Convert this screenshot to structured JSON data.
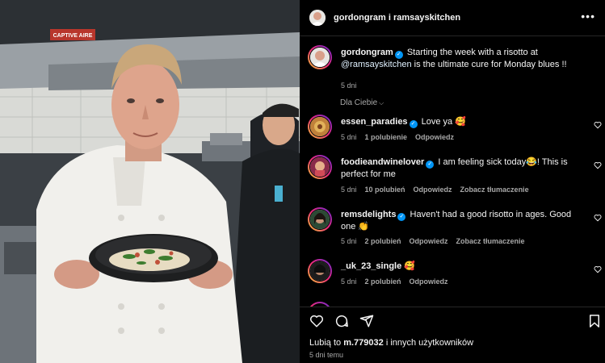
{
  "header": {
    "title": "gordongram i ramsayskitchen",
    "more_icon": "ellipsis-icon"
  },
  "photo": {
    "sign_text": "CAPTIVE AIRE"
  },
  "caption": {
    "username": "gordongram",
    "text_before": "Starting the week with a risotto at",
    "mention": "@ramsayskitchen",
    "text_after": "is the ultimate cure for Monday blues !!",
    "time": "5 dni"
  },
  "filter": {
    "label": "Dla Ciebie",
    "icon": "chevron-down-icon"
  },
  "comments": [
    {
      "username": "essen_paradies",
      "verified": true,
      "text": "Love ya 🥰",
      "time": "5 dni",
      "likes": "1 polubienie",
      "reply": "Odpowiedz",
      "translate": ""
    },
    {
      "username": "foodieandwinelover",
      "verified": true,
      "text": "I am feeling sick today😂! This is perfect for me",
      "time": "5 dni",
      "likes": "10 polubień",
      "reply": "Odpowiedz",
      "translate": "Zobacz tłumaczenie"
    },
    {
      "username": "remsdelights",
      "verified": true,
      "text": "Haven't had a good risotto in ages. Good one 👏",
      "time": "5 dni",
      "likes": "2 polubień",
      "reply": "Odpowiedz",
      "translate": "Zobacz tłumaczenie"
    },
    {
      "username": "_uk_23_single",
      "verified": false,
      "text": "🥰",
      "time": "5 dni",
      "likes": "2 polubień",
      "reply": "Odpowiedz",
      "translate": ""
    }
  ],
  "actions": {
    "like_icon": "heart-icon",
    "comment_icon": "comment-icon",
    "share_icon": "send-icon",
    "save_icon": "bookmark-icon"
  },
  "likes_summary": {
    "prefix": "Lubią to",
    "user": "m.779032",
    "suffix": "i innych użytkowników"
  },
  "post_time": "5 dni temu",
  "colors": {
    "background": "#000000",
    "text": "#f5f5f5",
    "muted": "#a8a8a8",
    "verified": "#0095f6",
    "mention": "#e0f1ff"
  }
}
